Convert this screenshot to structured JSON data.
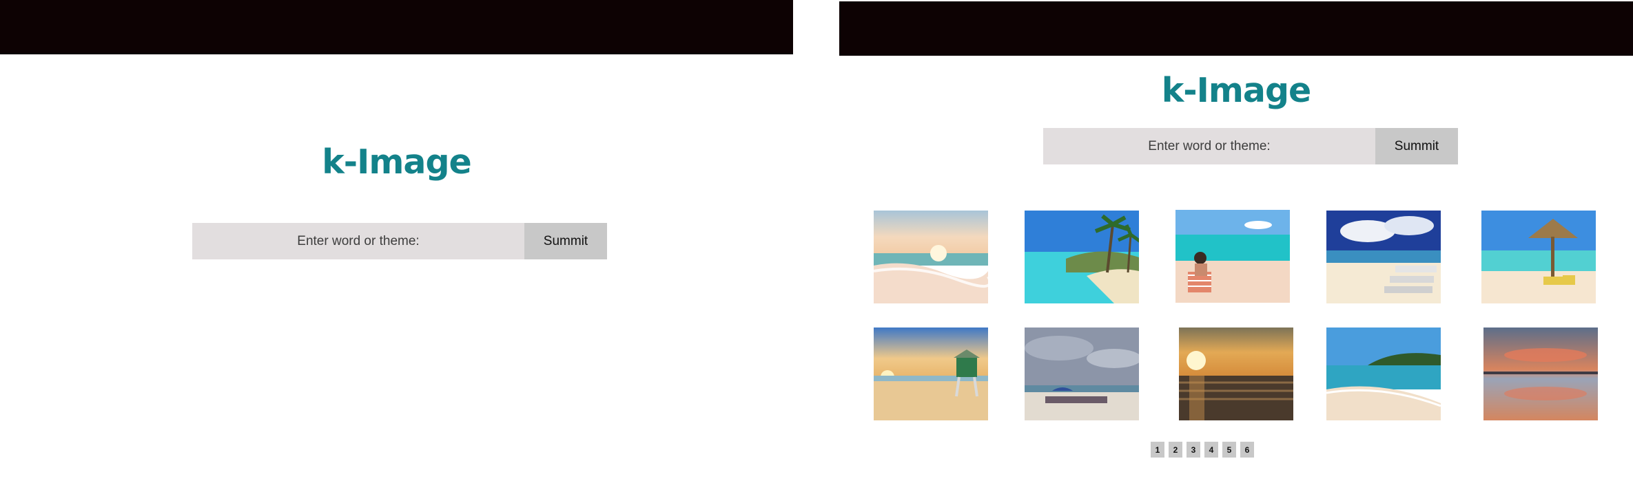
{
  "app": {
    "logo": "k-Image"
  },
  "search": {
    "placeholder": "Enter word or theme:",
    "submit_label": "Summit"
  },
  "results": {
    "images": [
      {
        "subject": "beach-sunrise-waves"
      },
      {
        "subject": "turquoise-water-palm-trees"
      },
      {
        "subject": "woman-in-beach-chair"
      },
      {
        "subject": "beach-loungers-clouds"
      },
      {
        "subject": "thatched-umbrella-chairs"
      },
      {
        "subject": "lifeguard-tower-sunset"
      },
      {
        "subject": "crowded-beach-cloudy"
      },
      {
        "subject": "ocean-sunset"
      },
      {
        "subject": "palm-island-shoreline"
      },
      {
        "subject": "reflective-sunset-sky"
      }
    ]
  },
  "pagination": {
    "pages": [
      "1",
      "2",
      "3",
      "4",
      "5",
      "6"
    ]
  },
  "colors": {
    "brand": "#13828a",
    "topbar": "#0d0203",
    "input_bg": "#e2dedf",
    "button_bg": "#c8c8c8"
  }
}
